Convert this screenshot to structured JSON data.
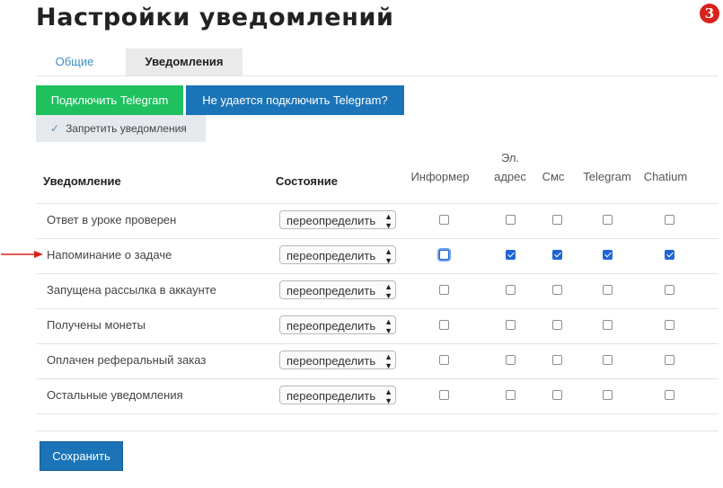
{
  "page": {
    "title": "Настройки уведомлений",
    "badge": "3"
  },
  "tabs": [
    {
      "label": "Общие",
      "active": false
    },
    {
      "label": "Уведомления",
      "active": true
    }
  ],
  "actions": {
    "connect_telegram": "Подключить Telegram",
    "telegram_help": "Не удается подключить Telegram?",
    "disable_notifications": "Запретить уведомления",
    "save": "Сохранить"
  },
  "table": {
    "headers": {
      "notification": "Уведомление",
      "state": "Состояние",
      "informer": "Информер",
      "email_1": "Эл.",
      "email_2": "адрес",
      "sms": "Смс",
      "telegram": "Telegram",
      "chatium": "Chatium"
    },
    "rows": [
      {
        "label": "Ответ в уроке проверен",
        "state": "переопределить",
        "channels": [
          false,
          false,
          false,
          false,
          false
        ]
      },
      {
        "label": "Напоминание о задаче",
        "state": "переопределить",
        "channels": [
          false,
          true,
          true,
          true,
          true
        ],
        "focused_channel": 0
      },
      {
        "label": "Запущена рассылка в аккаунте",
        "state": "переопределить",
        "channels": [
          false,
          false,
          false,
          false,
          false
        ]
      },
      {
        "label": "Получены монеты",
        "state": "переопределить",
        "channels": [
          false,
          false,
          false,
          false,
          false
        ]
      },
      {
        "label": "Оплачен реферальный заказ",
        "state": "переопределить",
        "channels": [
          false,
          false,
          false,
          false,
          false
        ]
      },
      {
        "label": "Остальные уведомления",
        "state": "переопределить",
        "channels": [
          false,
          false,
          false,
          false,
          false
        ]
      }
    ]
  },
  "colors": {
    "accent_green": "#1fc15e",
    "accent_blue": "#1b74b8",
    "checkbox_checked": "#2066d1",
    "badge_red": "#d9221c",
    "arrow_red": "#d9221c"
  },
  "icons": {
    "disable_check": "check-icon",
    "select_arrows": "updown-arrows-icon",
    "pointer": "arrow-right-icon"
  }
}
